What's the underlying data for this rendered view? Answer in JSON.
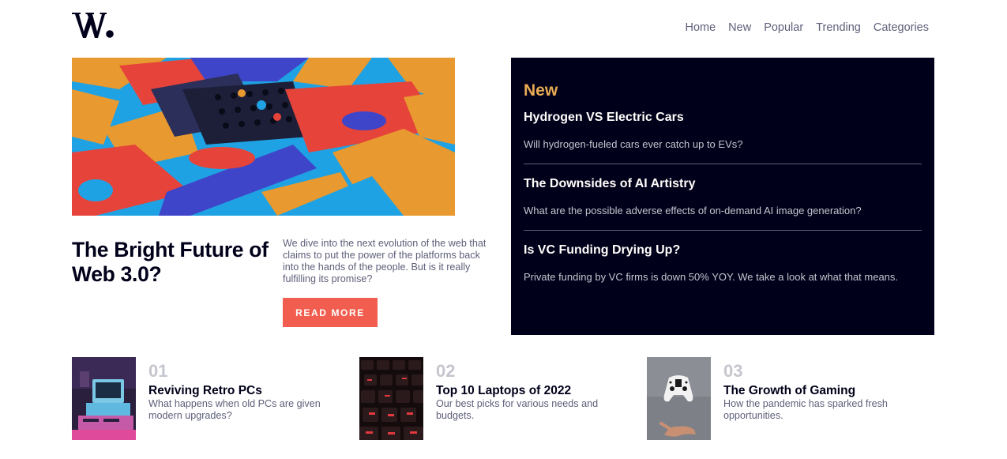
{
  "logo": {
    "text": "W."
  },
  "nav": [
    "Home",
    "New",
    "Popular",
    "Trending",
    "Categories"
  ],
  "hero": {
    "title": "The Bright Future of Web 3.0?",
    "description": "We dive into the next evolution of the web that claims to put the power of the platforms back into the hands of the people. But is it really fulfilling its promise?",
    "button": "READ MORE"
  },
  "new_panel": {
    "heading": "New",
    "items": [
      {
        "title": "Hydrogen VS Electric Cars",
        "description": "Will hydrogen-fueled cars ever catch up to EVs?"
      },
      {
        "title": "The Downsides of AI Artistry",
        "description": "What are the possible adverse effects of on-demand AI image generation?"
      },
      {
        "title": "Is VC Funding Drying Up?",
        "description": "Private funding by VC firms is down 50% YOY. We take a look at what that means."
      }
    ]
  },
  "cards": [
    {
      "number": "01",
      "title": "Reviving Retro PCs",
      "description": "What happens when old PCs are given modern upgrades?"
    },
    {
      "number": "02",
      "title": "Top 10 Laptops of 2022",
      "description": "Our best picks for various needs and budgets."
    },
    {
      "number": "03",
      "title": "The Growth of Gaming",
      "description": "How the pandemic has sparked fresh opportunities."
    }
  ],
  "colors": {
    "accent": "#f15e50",
    "gold": "#e9ab53",
    "dark": "#00001a",
    "grey": "#5d5f79"
  }
}
